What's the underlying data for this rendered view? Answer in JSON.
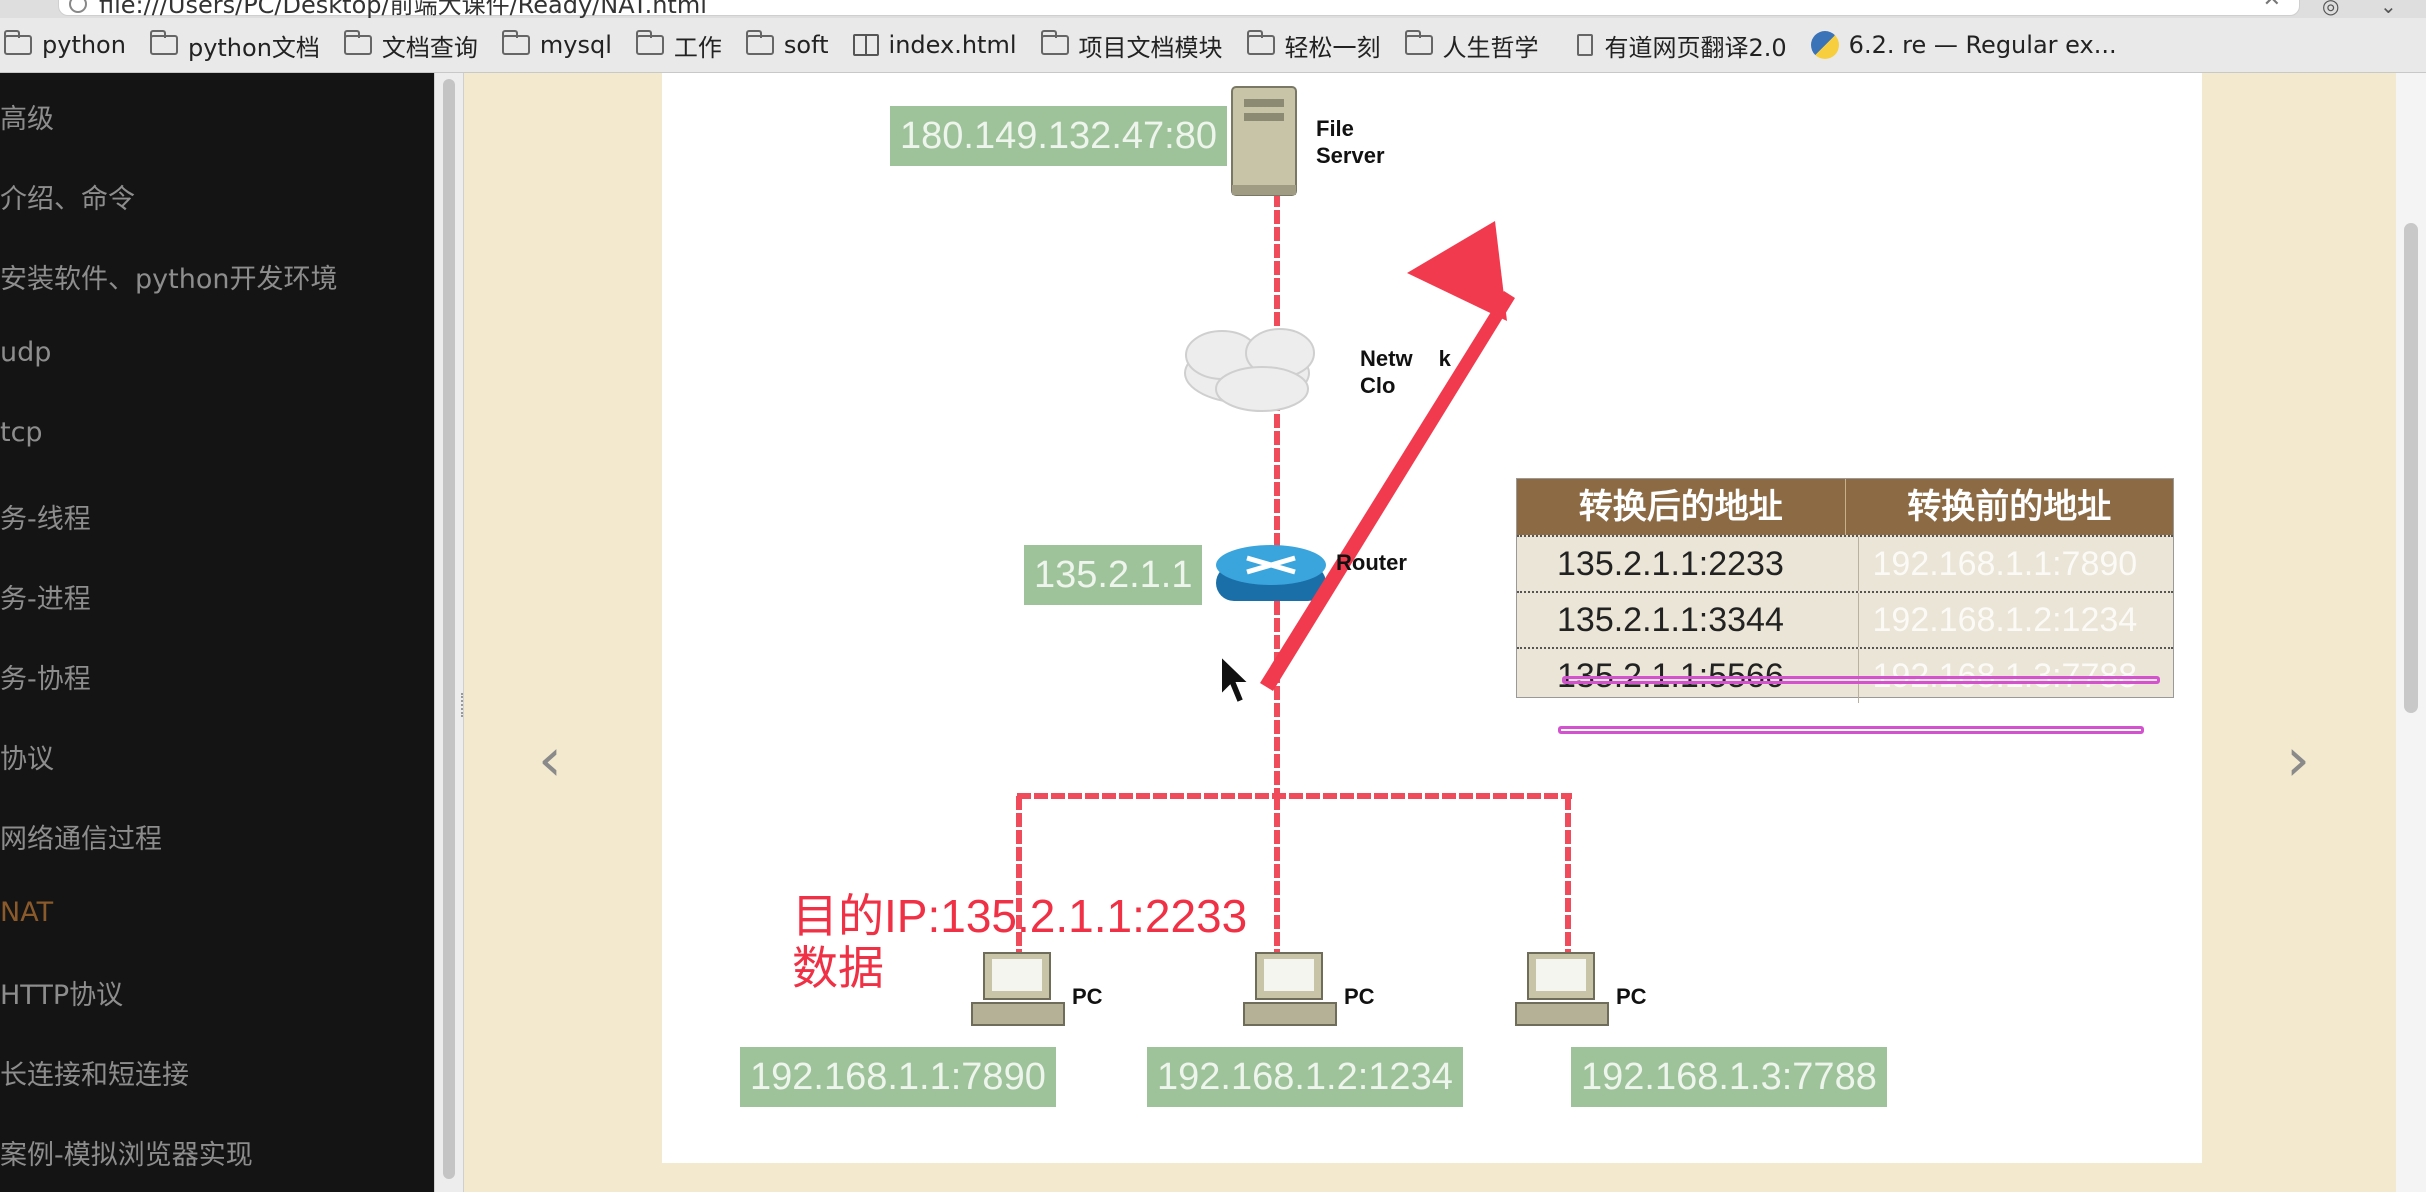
{
  "address_bar": {
    "url": "file:///Users/PC/Desktop/前端大课件/Ready/NAT.html"
  },
  "bookmarks": [
    {
      "label": "python",
      "icon": "folder-icon"
    },
    {
      "label": "python文档",
      "icon": "folder-icon"
    },
    {
      "label": "文档查询",
      "icon": "folder-icon"
    },
    {
      "label": "mysql",
      "icon": "folder-icon"
    },
    {
      "label": "工作",
      "icon": "folder-icon"
    },
    {
      "label": "soft",
      "icon": "folder-icon"
    },
    {
      "label": "index.html",
      "icon": "book-icon"
    },
    {
      "label": "项目文档模块",
      "icon": "folder-icon"
    },
    {
      "label": "轻松一刻",
      "icon": "folder-icon"
    },
    {
      "label": "人生哲学",
      "icon": "folder-icon"
    },
    {
      "label": "有道网页翻译2.0",
      "icon": "page-icon"
    },
    {
      "label": "6.2. re — Regular ex...",
      "icon": "python-logo-icon"
    }
  ],
  "sidebar": {
    "items": [
      {
        "label": "高级",
        "active": false
      },
      {
        "label": "介绍、命令",
        "active": false
      },
      {
        "label": "安装软件、python开发环境",
        "active": false
      },
      {
        "label": "udp",
        "active": false
      },
      {
        "label": "tcp",
        "active": false
      },
      {
        "label": "务-线程",
        "active": false
      },
      {
        "label": "务-进程",
        "active": false
      },
      {
        "label": "务-协程",
        "active": false
      },
      {
        "label": "协议",
        "active": false
      },
      {
        "label": "网络通信过程",
        "active": false
      },
      {
        "label": "NAT",
        "active": true
      },
      {
        "label": "HTTP协议",
        "active": false
      },
      {
        "label": "长连接和短连接",
        "active": false
      },
      {
        "label": "案例-模拟浏览器实现",
        "active": false
      }
    ]
  },
  "slide": {
    "server_ip": "180.149.132.47:80",
    "server_label_line1": "File",
    "server_label_line2": "Server",
    "cloud_label_line1": "Netw",
    "cloud_label_line1_tail": "k",
    "cloud_label_line2": "Clo",
    "router_ip": "135.2.1.1",
    "router_label": "Router",
    "pc_label": "PC",
    "pc_ips": [
      "192.168.1.1:7890",
      "192.168.1.2:1234",
      "192.168.1.3:7788"
    ],
    "dest_line1": "目的IP:135.2.1.1:2233",
    "dest_line2": "数据",
    "nat_table": {
      "headers": [
        "转换后的地址",
        "转换前的地址"
      ],
      "rows": [
        [
          "135.2.1.1:2233",
          "192.168.1.1:7890"
        ],
        [
          "135.2.1.1:3344",
          "192.168.1.2:1234"
        ],
        [
          "135.2.1.1:5566",
          "192.168.1.3:7788"
        ]
      ]
    }
  },
  "colors": {
    "sidebar_bg": "#141414",
    "sidebar_text": "#8d8d8d",
    "sidebar_active": "#8b5a2b",
    "page_bg": "#f2e9cf",
    "ip_tag_bg": "#9ec39a",
    "cable": "#ef4b5a",
    "arrow": "#f23a4e",
    "table_header": "#8b6a44",
    "highlight": "#d452cf"
  }
}
